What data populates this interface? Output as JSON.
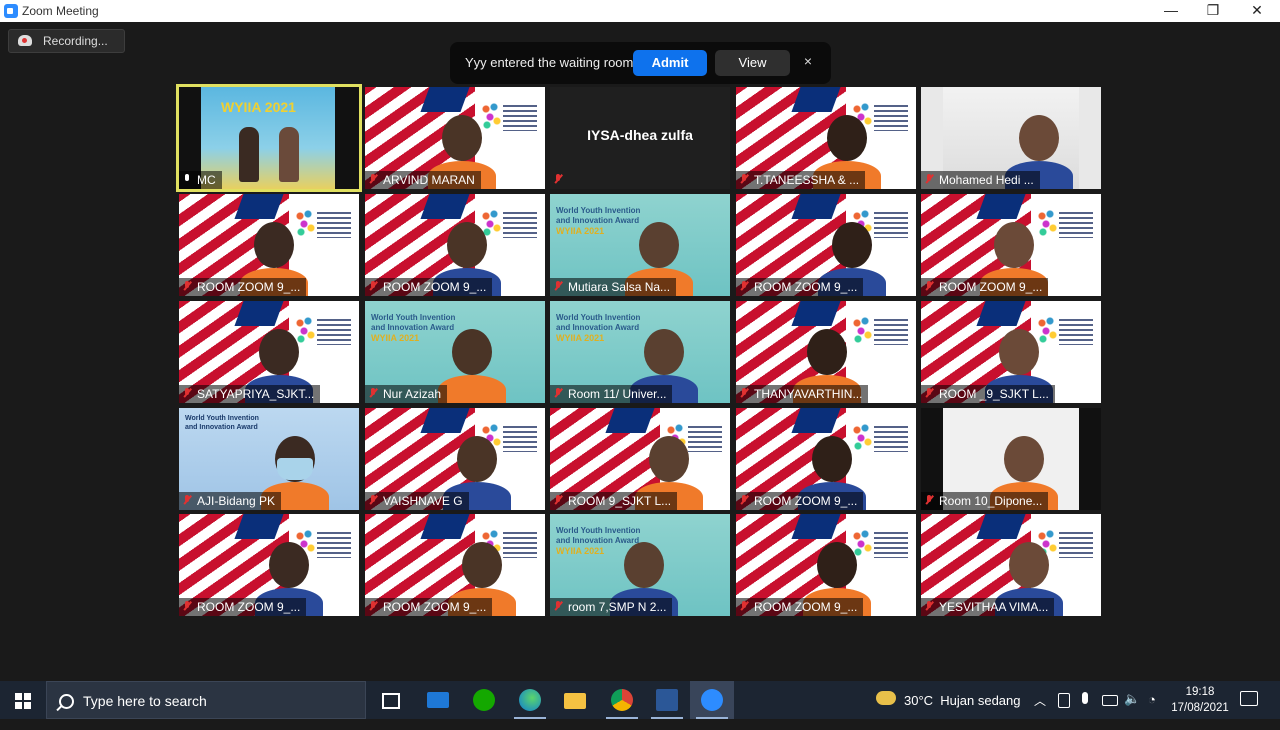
{
  "window": {
    "title": "Zoom Meeting",
    "minimize": "—",
    "restore": "❐",
    "close": "✕"
  },
  "recording": {
    "label": "Recording..."
  },
  "waiting_room": {
    "message": "Yyy entered the waiting room",
    "admit": "Admit",
    "view": "View",
    "close": "×"
  },
  "gallery": {
    "participants": [
      {
        "name": "MC",
        "mic": "on",
        "active": true
      },
      {
        "name": "ARVIND MARAN",
        "mic": "muted"
      },
      {
        "name": "",
        "display": "IYSA-dhea zulfa",
        "mic": "muted"
      },
      {
        "name": "T.TANEESSHA & ...",
        "mic": "muted"
      },
      {
        "name": "Mohamed Hedi ...",
        "mic": "muted"
      },
      {
        "name": "ROOM ZOOM 9_...",
        "mic": "muted"
      },
      {
        "name": "ROOM ZOOM 9_...",
        "mic": "muted"
      },
      {
        "name": "Mutiara Salsa Na...",
        "mic": "muted"
      },
      {
        "name": "ROOM ZOOM 9_...",
        "mic": "muted"
      },
      {
        "name": "ROOM ZOOM 9_...",
        "mic": "muted"
      },
      {
        "name": "SATYAPRIYA_SJKT...",
        "mic": "muted"
      },
      {
        "name": "Nur Azizah",
        "mic": "muted"
      },
      {
        "name": "Room 11/ Univer...",
        "mic": "muted"
      },
      {
        "name": "THANYAVARTHIN...",
        "mic": "muted"
      },
      {
        "name": "ROOM _9_SJKT L...",
        "mic": "muted"
      },
      {
        "name": "AJI-Bidang PK",
        "mic": "muted"
      },
      {
        "name": "VAISHNAVE G",
        "mic": "muted"
      },
      {
        "name": "ROOM 9_SJKT L...",
        "mic": "muted"
      },
      {
        "name": "ROOM ZOOM 9_...",
        "mic": "muted"
      },
      {
        "name": "Room 10_Dipone...",
        "mic": "muted"
      },
      {
        "name": "ROOM ZOOM 9_...",
        "mic": "muted"
      },
      {
        "name": "ROOM ZOOM 9_...",
        "mic": "muted"
      },
      {
        "name": "room 7,SMP N 2...",
        "mic": "muted"
      },
      {
        "name": "ROOM ZOOM 9_...",
        "mic": "muted"
      },
      {
        "name": "YESVITHAA VIMA...",
        "mic": "muted"
      }
    ],
    "backgrounds": {
      "wyiia_banner_line1": "World Youth Invention",
      "wyiia_banner_line2": "and Innovation Award",
      "wyiia_banner_year": "WYIIA 2021",
      "mc_banner": "WYIIA 2021"
    }
  },
  "taskbar": {
    "search_placeholder": "Type here to search",
    "weather": "30°C  Hujan sedang",
    "time": "19:18",
    "date": "17/08/2021",
    "apps": [
      "task-view",
      "mail",
      "upwork",
      "edge",
      "file-explorer",
      "chrome",
      "word",
      "zoom"
    ]
  },
  "colors": {
    "admit": "#0e72ed",
    "active_speaker": "#e0e060",
    "muted": "#e03131"
  }
}
